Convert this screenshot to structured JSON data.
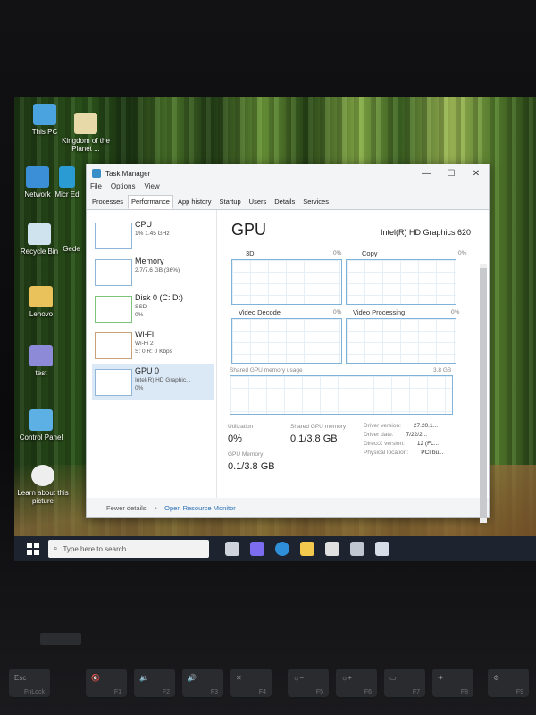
{
  "desktop_icons": [
    "This PC",
    "Kingdom of the Planet ...",
    "Network",
    "Micr Ed",
    "Recycle Bin",
    "Gede",
    "Lenovo",
    "test",
    "Control Panel",
    "Learn about this picture"
  ],
  "window": {
    "title": "Task Manager",
    "controls": [
      "—",
      "☐",
      "✕"
    ],
    "menu": [
      "File",
      "Options",
      "View"
    ],
    "tabs": [
      "Processes",
      "Performance",
      "App history",
      "Startup",
      "Users",
      "Details",
      "Services"
    ],
    "active_tab": "Performance"
  },
  "resources": [
    {
      "name": "CPU",
      "sub1": "1%  1.45 GHz",
      "sub2": ""
    },
    {
      "name": "Memory",
      "sub1": "2.7/7.6 GB (36%)",
      "sub2": ""
    },
    {
      "name": "Disk 0 (C: D:)",
      "sub1": "SSD",
      "sub2": "0%"
    },
    {
      "name": "Wi-Fi",
      "sub1": "Wi-Fi 2",
      "sub2": "S: 0  R: 0 Kbps"
    },
    {
      "name": "GPU 0",
      "sub1": "Intel(R) HD Graphic...",
      "sub2": "0%"
    }
  ],
  "gpu": {
    "title": "GPU",
    "model": "Intel(R) HD Graphics 620",
    "engines": [
      {
        "label": "3D",
        "pct": "0%"
      },
      {
        "label": "Copy",
        "pct": "0%"
      },
      {
        "label": "Video Decode",
        "pct": "0%"
      },
      {
        "label": "Video Processing",
        "pct": "0%"
      }
    ],
    "shared_memory_label": "Shared GPU memory usage",
    "shared_memory_max": "3.8 GB",
    "utilization_label": "Utilization",
    "utilization": "0%",
    "shared_mem_label": "Shared GPU memory",
    "shared_mem": "0.1/3.8 GB",
    "gpu_memory_label": "GPU Memory",
    "gpu_memory": "0.1/3.8 GB",
    "details": [
      {
        "k": "Driver version:",
        "v": "27.20.1..."
      },
      {
        "k": "Driver date:",
        "v": "7/22/2..."
      },
      {
        "k": "DirectX version:",
        "v": "12 (FL..."
      },
      {
        "k": "Physical location:",
        "v": "PCI bu..."
      }
    ]
  },
  "footer": {
    "fewer": "Fewer details",
    "monitor": "Open Resource Monitor"
  },
  "taskbar": {
    "search_placeholder": "Type here to search"
  },
  "keyboard": [
    {
      "k": "Esc",
      "f": "FnLock"
    },
    {
      "k": "🔇",
      "f": "F1"
    },
    {
      "k": "🔉",
      "f": "F2"
    },
    {
      "k": "🔊",
      "f": "F3"
    },
    {
      "k": "✕",
      "f": "F4"
    },
    {
      "k": "☼−",
      "f": "F5"
    },
    {
      "k": "☼+",
      "f": "F6"
    },
    {
      "k": "▭",
      "f": "F7"
    },
    {
      "k": "✈",
      "f": "F8"
    },
    {
      "k": "⚙",
      "f": "F9"
    }
  ]
}
